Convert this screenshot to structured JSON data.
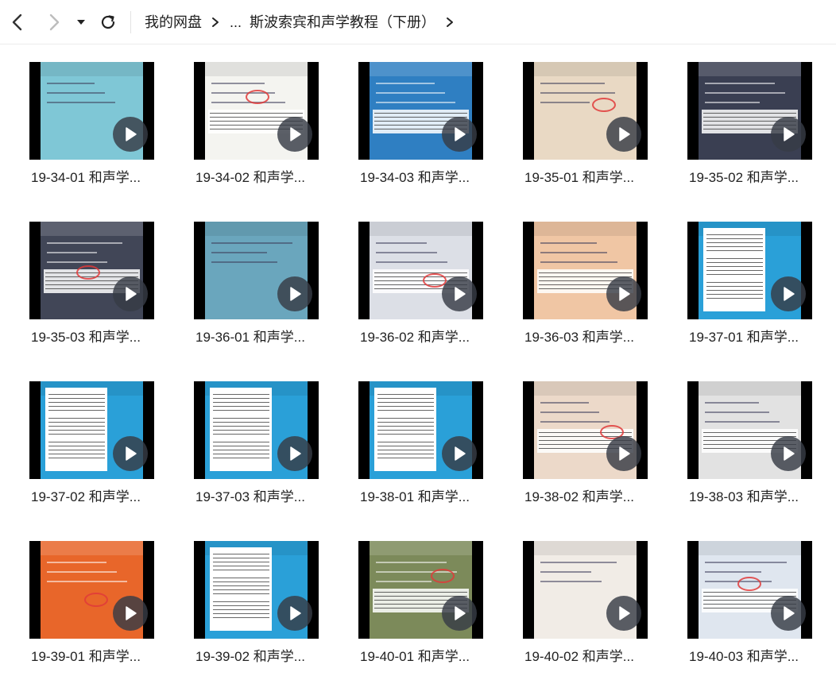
{
  "toolbar": {
    "back_icon": "chevron-left-icon",
    "forward_icon": "chevron-right-icon",
    "dropdown_icon": "caret-down-icon",
    "refresh_icon": "refresh-icon"
  },
  "breadcrumb": {
    "root": "我的网盘",
    "ellipsis": "...",
    "current": "斯波索宾和声学教程（下册）"
  },
  "colors": {
    "thumb_bg": "#000000",
    "play_bg": "#373c46",
    "annotation_red": "#e03a3a"
  },
  "videos": [
    {
      "caption": "19-34-01 和声学...",
      "theme": "#7fc7d6"
    },
    {
      "caption": "19-34-02 和声学...",
      "theme": "#f4f4f0"
    },
    {
      "caption": "19-34-03 和声学...",
      "theme": "#2f7fc2"
    },
    {
      "caption": "19-35-01 和声学...",
      "theme": "#e9d9c4"
    },
    {
      "caption": "19-35-02 和声学...",
      "theme": "#3a3f52"
    },
    {
      "caption": "19-35-03 和声学...",
      "theme": "#414657"
    },
    {
      "caption": "19-36-01 和声学...",
      "theme": "#6aa6bd"
    },
    {
      "caption": "19-36-02 和声学...",
      "theme": "#dcdfe6"
    },
    {
      "caption": "19-36-03 和声学...",
      "theme": "#f0c6a4"
    },
    {
      "caption": "19-37-01 和声学...",
      "theme": "#2aa0d8"
    },
    {
      "caption": "19-37-02 和声学...",
      "theme": "#2aa0d8"
    },
    {
      "caption": "19-37-03 和声学...",
      "theme": "#2aa0d8"
    },
    {
      "caption": "19-38-01 和声学...",
      "theme": "#2aa0d8"
    },
    {
      "caption": "19-38-02 和声学...",
      "theme": "#ecd9c9"
    },
    {
      "caption": "19-38-03 和声学...",
      "theme": "#e2e2e2"
    },
    {
      "caption": "19-39-01 和声学...",
      "theme": "#e8662a"
    },
    {
      "caption": "19-39-02 和声学...",
      "theme": "#2aa0d8"
    },
    {
      "caption": "19-40-01 和声学...",
      "theme": "#7c8a5a"
    },
    {
      "caption": "19-40-02 和声学...",
      "theme": "#f1ece6"
    },
    {
      "caption": "19-40-03 和声学...",
      "theme": "#dfe6ef"
    }
  ]
}
